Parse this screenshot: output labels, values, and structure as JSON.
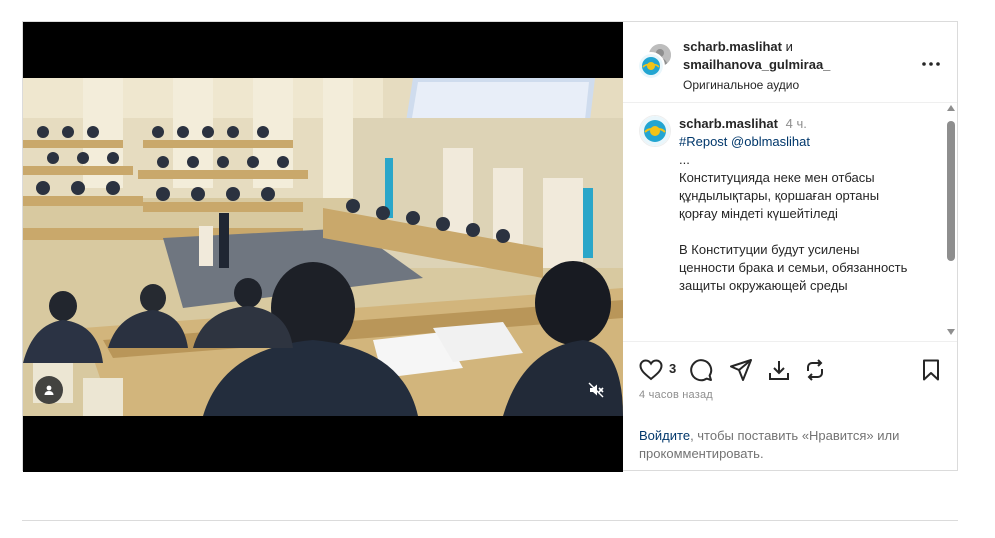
{
  "post": {
    "authors": {
      "primary": "scharb.maslihat",
      "conjunction": "и",
      "secondary": "smailhanova_gulmiraa_"
    },
    "audio": "Оригинальное аудио",
    "more_icon": "more-horizontal-icon",
    "comment": {
      "username": "scharb.maslihat",
      "time": "4 ч.",
      "repost": "#Repost @oblmaslihat",
      "lines": [
        "...",
        "Конституцияда неке мен отбасы",
        "құндылықтары, қоршаған ортаны",
        "қорғау міндеті күшейтіледі",
        "",
        "В Конституции будут усилены",
        "ценности брака и семьи, обязанность",
        "защиты окружающей среды"
      ]
    },
    "load_more_icon": "plus-circle-icon",
    "actions": {
      "like_icon": "heart-icon",
      "like_count": "3",
      "comment_icon": "comment-icon",
      "share_icon": "send-icon",
      "download_icon": "download-icon",
      "repost_icon": "repost-icon",
      "save_icon": "bookmark-icon"
    },
    "time_ago": "4 часов назад",
    "login_prompt": {
      "link": "Войдите",
      "text": ", чтобы поставить «Нравится» или прокомментировать."
    },
    "media": {
      "muted_icon": "speaker-muted-icon",
      "tag_icon": "user-tag-icon"
    }
  },
  "colors": {
    "link": "#00376b",
    "secondary_text": "#8e8e8e",
    "border": "#dbdbdb"
  }
}
